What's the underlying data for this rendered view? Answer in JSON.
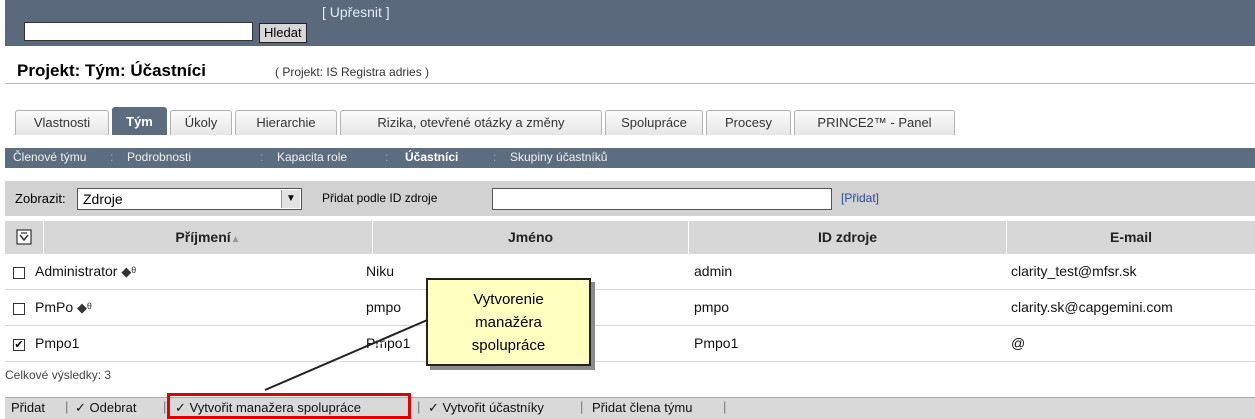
{
  "search": {
    "button_label": "Hledat",
    "refine_label": "[ Upřesnit ]"
  },
  "page": {
    "title": "Projekt: Tým: Účastníci",
    "subtitle": "( Projekt: IS Registra adries )"
  },
  "tabs": [
    {
      "label": "Vlastnosti"
    },
    {
      "label": "Tým"
    },
    {
      "label": "Úkoly"
    },
    {
      "label": "Hierarchie"
    },
    {
      "label": "Rizika, otevřené otázky a změny"
    },
    {
      "label": "Spolupráce"
    },
    {
      "label": "Procesy"
    },
    {
      "label": "PRINCE2™ - Panel"
    }
  ],
  "active_tab": "Tým",
  "subnav": [
    {
      "label": "Členové týmu"
    },
    {
      "label": "Podrobnosti"
    },
    {
      "label": "Kapacita role"
    },
    {
      "label": "Účastníci"
    },
    {
      "label": "Skupiny účastníků"
    }
  ],
  "active_subnav": "Účastníci",
  "filter": {
    "show_label": "Zobrazit:",
    "show_value": "Zdroje",
    "add_by_id_label": "Přidat podle ID zdroje",
    "add_link": "[Přidat]"
  },
  "table": {
    "columns": [
      "Příjmení",
      "Jméno",
      "ID zdroje",
      "E-mail"
    ],
    "sort_indicator": "▲",
    "rows": [
      {
        "checked": false,
        "surname": "Administrator",
        "name": "Niku",
        "id": "admin",
        "email": "clarity_test@mfsr.sk"
      },
      {
        "checked": false,
        "surname": "PmPo",
        "name": "pmpo",
        "id": "pmpo",
        "email": "clarity.sk@capgemini.com"
      },
      {
        "checked": true,
        "surname": "Pmpo1",
        "name": "Pmpo1",
        "id": "Pmpo1",
        "email": "@"
      }
    ],
    "total_label": "Celkové výsledky: 3"
  },
  "toolbar": {
    "add": "Přidat",
    "remove": "✓ Odebrat",
    "create_manager": "✓ Vytvořit manažera spolupráce",
    "create_participants": "✓ Vytvořit účastníky",
    "add_member": "Přidat člena týmu"
  },
  "callout": {
    "lines": [
      "Vytvorenie",
      "manažéra",
      "spolupráce"
    ]
  },
  "colors": {
    "header_bg": "#5a6a7c",
    "highlight": "#e00000",
    "callout_bg": "#ffffc0"
  }
}
